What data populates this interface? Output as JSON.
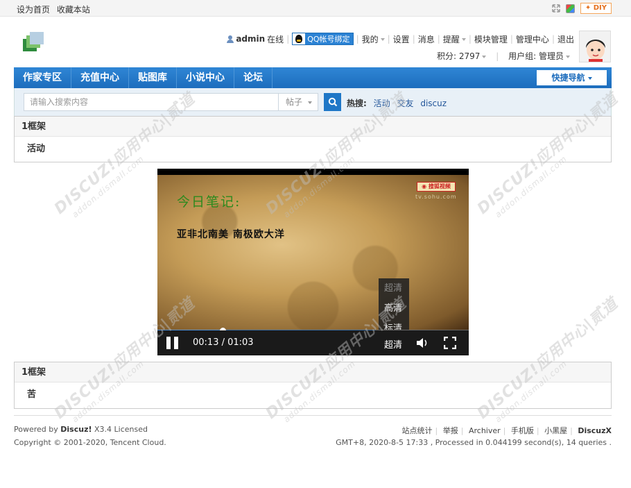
{
  "topbar": {
    "set_home": "设为首页",
    "bookmark": "收藏本站",
    "diy_label": "DIY",
    "icons": [
      "expand-icon",
      "skin-icon"
    ]
  },
  "header": {
    "username": "admin",
    "online_status": "在线",
    "qq_bind": "QQ帐号绑定",
    "links": [
      "我的",
      "设置",
      "消息",
      "提醒",
      "模块管理",
      "管理中心",
      "退出"
    ],
    "points": "积分: 2797",
    "usergroup": "用户组: 管理员"
  },
  "nav": {
    "items": [
      "作家专区",
      "充值中心",
      "贴图库",
      "小说中心",
      "论坛"
    ],
    "quick_nav": "快捷导航"
  },
  "search": {
    "placeholder": "请输入搜索内容",
    "type": "帖子",
    "hot_label": "热搜:",
    "hot_terms": [
      "活动",
      "交友",
      "discuz"
    ]
  },
  "frame1": {
    "title": "1框架",
    "content": "活动"
  },
  "video": {
    "note_title": "今日笔记:",
    "note_text": "亚非北南美  南极欧大洋",
    "brand_url": "tv.sohu.com",
    "quality_options": [
      "超清",
      "高清",
      "标清"
    ],
    "current_quality": "超清",
    "time": "00:13 / 01:03",
    "progress_fraction": 0.21,
    "buffer_fraction": 0.7
  },
  "frame2": {
    "title": "1框架",
    "content": "苦"
  },
  "watermark": {
    "text": "DISCUZ!应用中心|贰道",
    "sub": "addon.dismall.com"
  },
  "footer": {
    "powered_prefix": "Powered by",
    "powered_brand": "Discuz!",
    "powered_suffix": "X3.4 Licensed",
    "copyright": "Copyright © 2001-2020, Tencent Cloud.",
    "links": [
      "站点统计",
      "举报",
      "Archiver",
      "手机版",
      "小黑屋"
    ],
    "brand": "DiscuzX",
    "stats": "GMT+8, 2020-8-5 17:33 , Processed in 0.044199 second(s), 14 queries ."
  },
  "colors": {
    "nav_blue": "#1d6dbd",
    "accent_orange": "#e5701e"
  }
}
